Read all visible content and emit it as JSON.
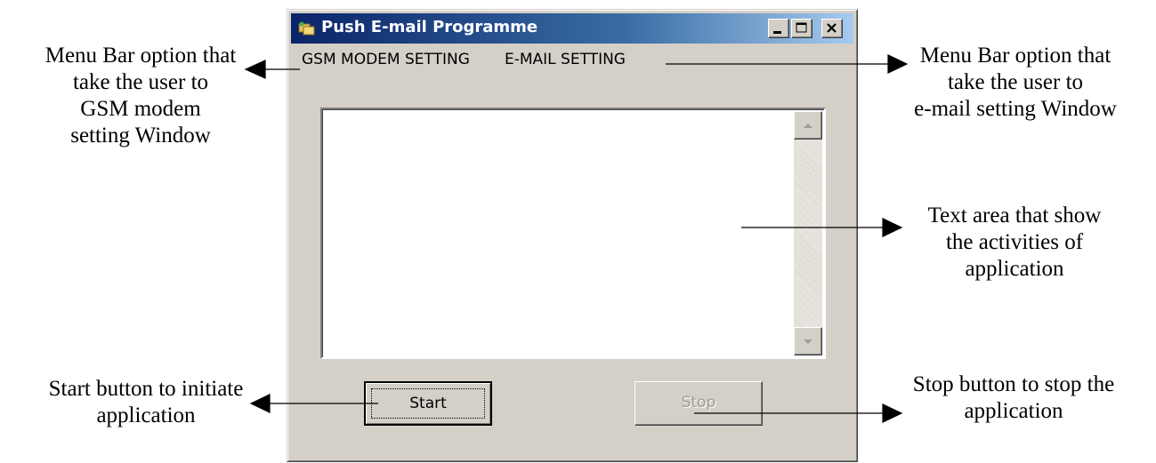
{
  "window": {
    "title": "Push E-mail Programme"
  },
  "menu": {
    "gsm_modem_setting": "GSM MODEM SETTING",
    "email_setting": "E-MAIL SETTING"
  },
  "buttons": {
    "start": "Start",
    "stop": "Stop"
  },
  "annotations": {
    "gsm_menu": [
      "Menu Bar option that",
      "take the user to",
      "GSM modem",
      "setting Window"
    ],
    "email_menu": [
      "Menu Bar option that",
      "take the user to",
      "e-mail setting Window"
    ],
    "text_area": [
      "Text area that show",
      "the activities of",
      "application"
    ],
    "start_button": [
      "Start button to initiate",
      "application"
    ],
    "stop_button": [
      "Stop button to stop the",
      "application"
    ]
  },
  "colors": {
    "title_gradient_start": "#0a246a",
    "title_gradient_end": "#a6caf0",
    "face": "#d4d0c8"
  }
}
